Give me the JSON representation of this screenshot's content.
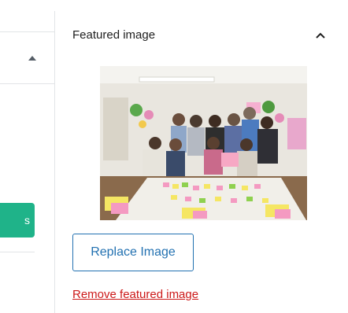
{
  "left_panel": {
    "button_label": "s"
  },
  "featured_image_panel": {
    "title": "Featured image",
    "toggle_icon": "chevron-up-icon",
    "replace_button": "Replace Image",
    "remove_link": "Remove featured image"
  },
  "colors": {
    "accent_blue": "#2271b1",
    "remove_red": "#cc1818",
    "primary_green": "#1fb389",
    "divider": "#e2e4e7"
  }
}
